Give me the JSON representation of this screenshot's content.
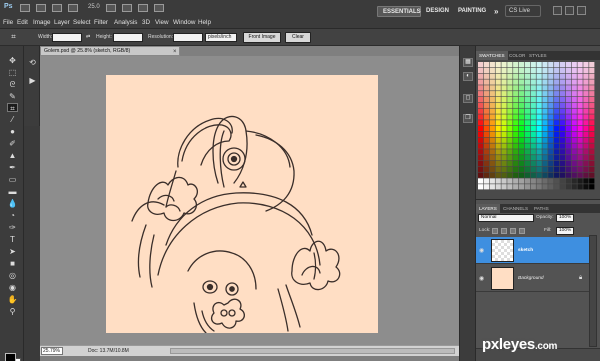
{
  "app": {
    "logo": "Ps",
    "zoom_menu": "25.0"
  },
  "workspace": {
    "essentials": "ESSENTIALS",
    "design": "DESIGN",
    "painting": "PAINTING",
    "more": "»",
    "cs_live": "CS Live"
  },
  "menu": [
    "File",
    "Edit",
    "Image",
    "Layer",
    "Select",
    "Filter",
    "Analysis",
    "3D",
    "View",
    "Window",
    "Help"
  ],
  "options": {
    "width_label": "Width:",
    "height_label": "Height:",
    "resolution_label": "Resolution:",
    "resolution_unit": "pixels/inch",
    "front_image": "Front Image",
    "clear": "Clear"
  },
  "document": {
    "tab_title": "Golem.psd @ 25.8% (sketch, RGB/8)",
    "close": "×",
    "zoom": "25.79%",
    "info": "Doc: 13.7M/10.8M",
    "canvas_color": "#ffdec4"
  },
  "swatch_panel": {
    "tabs": [
      "SWATCHES",
      "COLOR",
      "STYLES"
    ],
    "active": "SWATCHES"
  },
  "layers_panel": {
    "tabs": [
      "LAYERS",
      "CHANNELS",
      "PATHS"
    ],
    "blend_mode": "Normal",
    "opacity_label": "Opacity:",
    "opacity": "100%",
    "lock_label": "Lock:",
    "fill_label": "Fill:",
    "fill": "100%",
    "layers": [
      {
        "name": "sketch",
        "selected": true
      },
      {
        "name": "Background",
        "selected": false
      }
    ]
  },
  "watermark": {
    "main": "pxleyes",
    "suffix": ".com"
  },
  "colors": {
    "selection": "#3e8fe0",
    "panel": "#535353"
  }
}
